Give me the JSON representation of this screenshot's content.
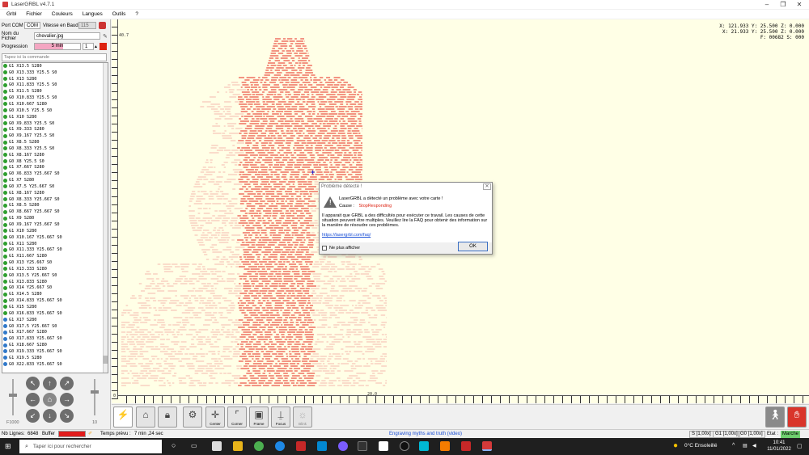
{
  "window": {
    "title": "LaserGRBL v4.7.1"
  },
  "menu": [
    "Grbl",
    "Fichier",
    "Couleurs",
    "Langues",
    "Outils",
    "?"
  ],
  "connection": {
    "port_label": "Port COM",
    "port_value": "COM",
    "baud_label": "Vitesse en Baud",
    "baud_value": "115",
    "file_label": "Nom du Fichier",
    "file_value": "chevalier.jpg",
    "progress_label": "Progression",
    "progress_text": "5 min",
    "progress_fraction": 0.62,
    "copies_value": "1",
    "command_placeholder": "Tapez ici la commande"
  },
  "gcode_lines": [
    {
      "text": "G1 X13.5 S280",
      "done": true
    },
    {
      "text": "G0 X13.333 Y25.5 S0",
      "done": true
    },
    {
      "text": "G1 X13 S280",
      "done": true
    },
    {
      "text": "G0 X11.833 Y25.5 S0",
      "done": true
    },
    {
      "text": "G1 X11.5 S280",
      "done": true
    },
    {
      "text": "G0 X10.833 Y25.5 S0",
      "done": true
    },
    {
      "text": "G1 X10.667 S280",
      "done": true
    },
    {
      "text": "G0 X10.5 Y25.5 S0",
      "done": true
    },
    {
      "text": "G1 X10 S280",
      "done": true
    },
    {
      "text": "G0 X9.833 Y25.5 S0",
      "done": true
    },
    {
      "text": "G1 X9.333 S280",
      "done": true
    },
    {
      "text": "G0 X9.167 Y25.5 S0",
      "done": true
    },
    {
      "text": "G1 X8.5 S280",
      "done": true
    },
    {
      "text": "G0 X8.333 Y25.5 S0",
      "done": true
    },
    {
      "text": "G1 X8.167 S280",
      "done": true
    },
    {
      "text": "G0 X8 Y25.5 S0",
      "done": true
    },
    {
      "text": "G1 X7.667 S280",
      "done": true
    },
    {
      "text": "G0 X6.833 Y25.667 S0",
      "done": true
    },
    {
      "text": "G1 X7 S280",
      "done": true
    },
    {
      "text": "G0 X7.5 Y25.667 S0",
      "done": true
    },
    {
      "text": "G1 X8.167 S280",
      "done": true
    },
    {
      "text": "G0 X8.333 Y25.667 S0",
      "done": true
    },
    {
      "text": "G1 X8.5 S280",
      "done": true
    },
    {
      "text": "G0 X8.667 Y25.667 S0",
      "done": true
    },
    {
      "text": "G1 X9 S280",
      "done": true
    },
    {
      "text": "G0 X9.167 Y25.667 S0",
      "done": true
    },
    {
      "text": "G1 X10 S280",
      "done": true
    },
    {
      "text": "G0 X10.167 Y25.667 S0",
      "done": true
    },
    {
      "text": "G1 X11 S280",
      "done": true
    },
    {
      "text": "G0 X11.333 Y25.667 S0",
      "done": true
    },
    {
      "text": "G1 X11.667 S280",
      "done": true
    },
    {
      "text": "G0 X13 Y25.667 S0",
      "done": true
    },
    {
      "text": "G1 X13.333 S280",
      "done": true
    },
    {
      "text": "G0 X13.5 Y25.667 S0",
      "done": true
    },
    {
      "text": "G1 X13.833 S280",
      "done": true
    },
    {
      "text": "G0 X14 Y25.667 S0",
      "done": true
    },
    {
      "text": "G1 X14.5 S280",
      "done": true
    },
    {
      "text": "G0 X14.833 Y25.667 S0",
      "done": true
    },
    {
      "text": "G1 X15 S280",
      "done": true
    },
    {
      "text": "G0 X16.833 Y25.667 S0",
      "done": true
    },
    {
      "text": "G1 X17 S280",
      "done": false
    },
    {
      "text": "G0 X17.5 Y25.667 S0",
      "done": false
    },
    {
      "text": "G1 X17.667 S280",
      "done": false
    },
    {
      "text": "G0 X17.833 Y25.667 S0",
      "done": false
    },
    {
      "text": "G1 X18.667 S280",
      "done": false
    },
    {
      "text": "G0 X19.333 Y25.667 S0",
      "done": false
    },
    {
      "text": "G1 X19.5 S280",
      "done": false
    },
    {
      "text": "G0 X22.833 Y25.667 S0",
      "done": false
    }
  ],
  "jog": {
    "feed_label": "F1000",
    "step_label": "10"
  },
  "canvas": {
    "coords_line1": "X: 121.933 Y: 25.500 Z: 0.000",
    "coords_line2": "X: 21.933 Y: 25.500 Z: 0.000",
    "coords_line3": "F: 00682 S: 000",
    "y_top_label": "40.7",
    "x_mid_label": "20.0",
    "origin_label": "0",
    "engraving_color": "#f07a6a",
    "background_color": "#ffffe6"
  },
  "toolbar": {
    "center": "Center",
    "corner": "Corner",
    "frame": "Frame",
    "focus": "Focus",
    "blink": "Blink"
  },
  "dialog": {
    "title": "Problème détecté !",
    "close": "✕",
    "headline": "LaserGRBL a détecté un problème avec votre carte !",
    "cause_label": "Cause :",
    "cause_value": "StopResponding",
    "body": "Il apparait que GRBL a des difficultés pour exécuter ce travail. Les causes de cette situation peuvent être multiples. Veuillez lire la FAQ pour obtenir des information sur la manière de résoudre ces problèmes.",
    "link": "https://lasergrbl.com/faq/",
    "checkbox_label": "Ne plus afficher",
    "ok": "OK"
  },
  "status": {
    "lines_label": "Nb Lignes:",
    "lines_value": "6848",
    "buffer_label": "Buffer",
    "time_label": "Temps prévu :",
    "time_value": "7 min ,24 sec",
    "song": "Engraving myths and truth (video)",
    "s_override": "S [1,00x]",
    "g1_override": "G1 [1,00x]",
    "g0_override": "G0 [1,00x]",
    "state_label": "Etat :",
    "state_value": "Marche"
  },
  "taskbar": {
    "search_placeholder": "Taper ici pour rechercher",
    "weather": "0°C  Ensoleillé",
    "time": "10:41",
    "date": "11/01/2022"
  }
}
